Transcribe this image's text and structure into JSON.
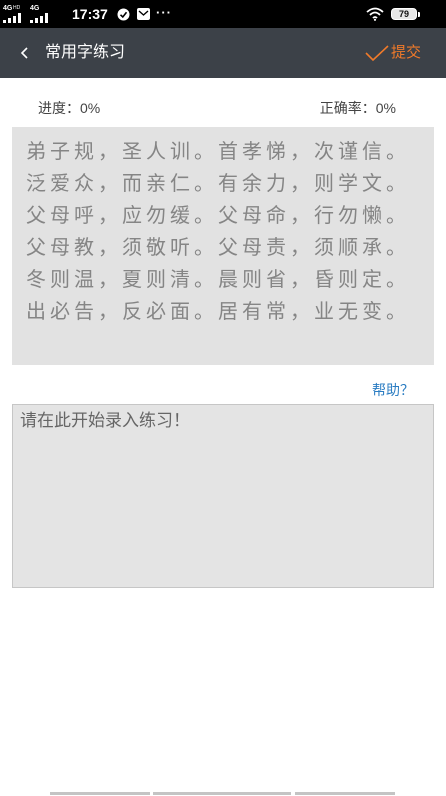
{
  "status_bar": {
    "network_1": "4G",
    "network_1_sub": "HD",
    "network_2": "4G",
    "time": "17:37",
    "more": "···",
    "battery": "79"
  },
  "header": {
    "title": "常用字练习",
    "submit_label": "提交",
    "back_icon": "chevron-left-icon",
    "submit_icon": "checkmark-icon"
  },
  "stats": {
    "progress_label": "进度：",
    "progress_value": "0%",
    "accuracy_label": "正确率：",
    "accuracy_value": "0%"
  },
  "practice": {
    "lines": [
      "弟子规，圣人训。首孝悌，次谨信。",
      "泛爱众，而亲仁。有余力，则学文。",
      "父母呼，应勿缓。父母命，行勿懒。",
      "父母教，须敬听。父母责，须顺承。",
      "冬则温，夏则清。晨则省，昏则定。",
      "出必告，反必面。居有常，业无变。"
    ]
  },
  "help_label": "帮助？",
  "input": {
    "placeholder": "请在此开始录入练习！"
  },
  "colors": {
    "status_bar_bg": "#000000",
    "header_bg": "#3c4148",
    "accent": "#f07a2a",
    "link": "#2a7cc2",
    "practice_bg": "#e2e2e2",
    "input_bg": "#e4e4e4"
  }
}
